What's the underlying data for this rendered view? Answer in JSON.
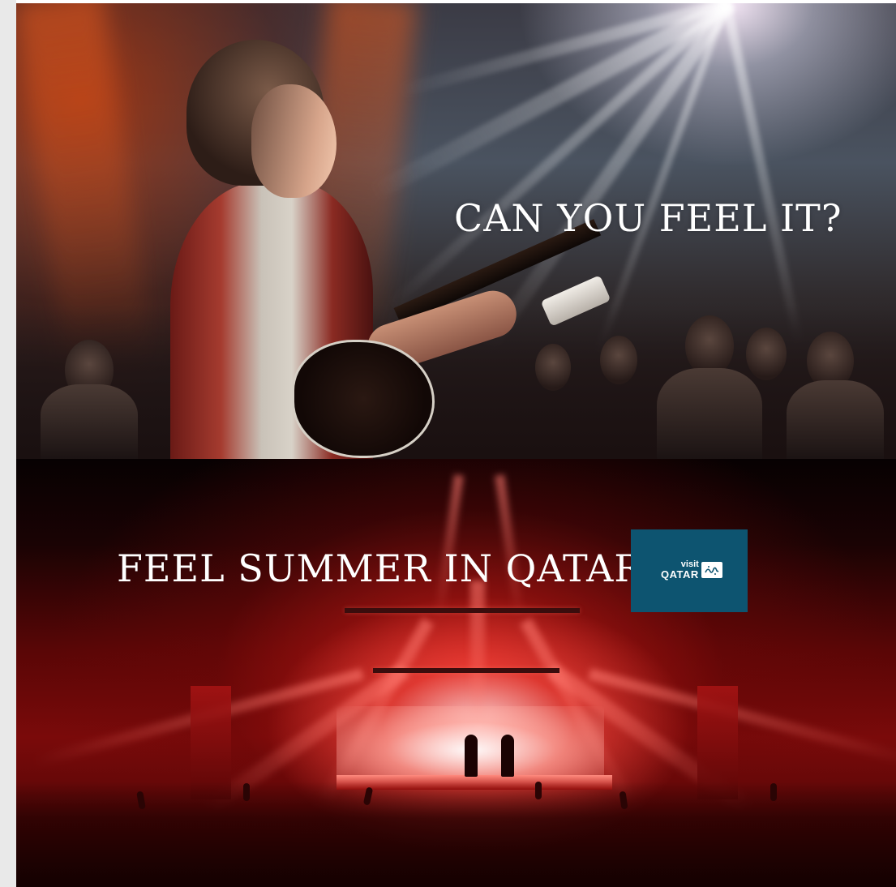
{
  "ad": {
    "top_headline": "CAN YOU FEEL IT?",
    "bottom_headline": "FEEL SUMMER IN QATAR",
    "logo": {
      "small_text": "visit",
      "big_text": "QATAR",
      "glyph_icon": "arabic-calligraphy-icon",
      "background_color": "#0d5470"
    }
  },
  "colors": {
    "headline_text": "#ffffff",
    "bottom_accent": "#c01010"
  }
}
